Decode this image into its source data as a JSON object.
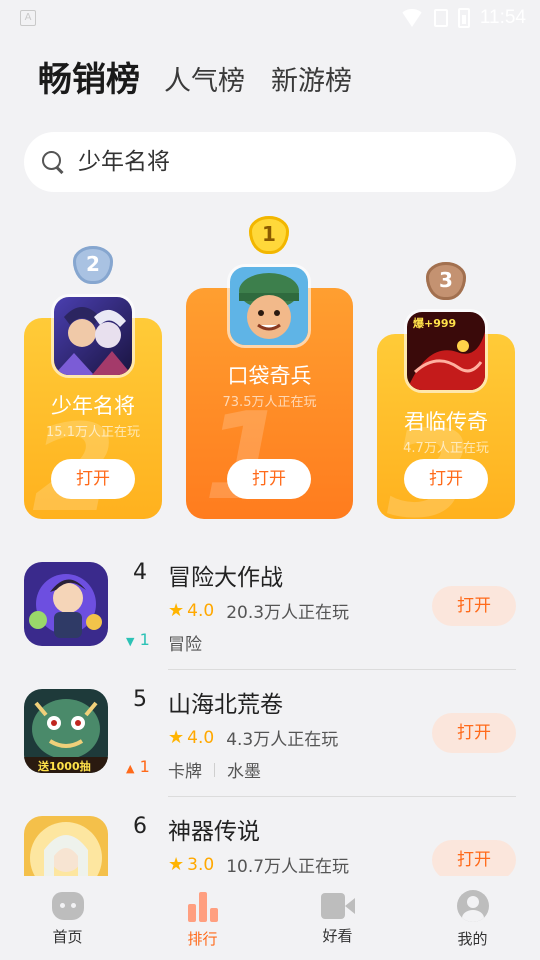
{
  "status_bar": {
    "time": "11:54",
    "notification_icon": "A"
  },
  "tabs": [
    {
      "label": "畅销榜",
      "active": true
    },
    {
      "label": "人气榜",
      "active": false
    },
    {
      "label": "新游榜",
      "active": false
    }
  ],
  "search": {
    "placeholder": "少年名将"
  },
  "podium": [
    {
      "rank": "1",
      "name": "口袋奇兵",
      "players": "73.5万人正在玩",
      "button": "打开",
      "badge_color": "#f5c21b"
    },
    {
      "rank": "2",
      "name": "少年名将",
      "players": "15.1万人正在玩",
      "button": "打开",
      "badge_color": "#9bb8dc"
    },
    {
      "rank": "3",
      "name": "君临传奇",
      "players": "4.7万人正在玩",
      "button": "打开",
      "badge_color": "#b07a56"
    }
  ],
  "podium_icon_text": {
    "game3": "爆+999"
  },
  "list": [
    {
      "rank": "4",
      "title": "冒险大作战",
      "rating": "4.0",
      "players": "20.3万人正在玩",
      "tags": [
        "冒险"
      ],
      "trend": "1",
      "trend_dir": "down",
      "button": "打开"
    },
    {
      "rank": "5",
      "title": "山海北荒卷",
      "rating": "4.0",
      "players": "4.3万人正在玩",
      "tags": [
        "卡牌",
        "水墨"
      ],
      "trend": "1",
      "trend_dir": "up",
      "button": "打开"
    },
    {
      "rank": "6",
      "title": "神器传说",
      "rating": "3.0",
      "players": "10.7万人正在玩",
      "tags": [],
      "trend": "",
      "trend_dir": "",
      "button": "打开"
    }
  ],
  "list_icon_text": {
    "game5": "送1000抽"
  },
  "bottom_nav": [
    {
      "label": "首页",
      "icon": "home-icon",
      "active": false
    },
    {
      "label": "排行",
      "icon": "ranking-icon",
      "active": true
    },
    {
      "label": "好看",
      "icon": "video-icon",
      "active": false
    },
    {
      "label": "我的",
      "icon": "profile-icon",
      "active": false
    }
  ],
  "colors": {
    "accent": "#ff6a1a",
    "gold_card": "#ffbe2c",
    "orange_card": "#ff8c26",
    "background": "#f2f2f4"
  }
}
